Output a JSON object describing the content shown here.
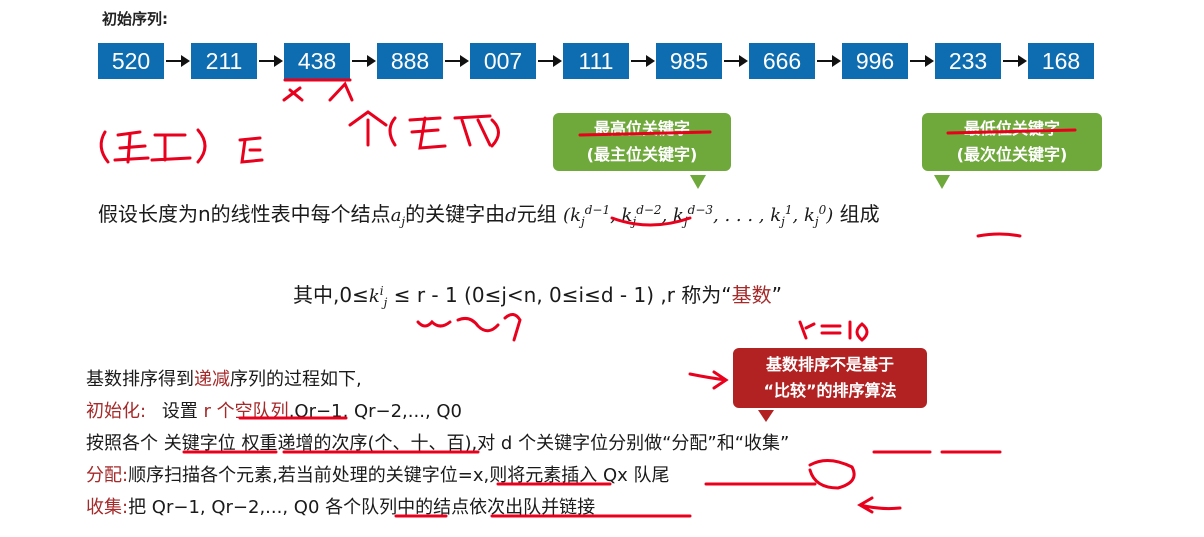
{
  "sequence": {
    "title": "初始序列:",
    "items": [
      "520",
      "211",
      "438",
      "888",
      "007",
      "111",
      "985",
      "666",
      "996",
      "233",
      "168"
    ]
  },
  "callouts": {
    "msd_line1": "最高位关键字",
    "msd_line2": "(最主位关键字)",
    "lsd_line1": "最低位关键字",
    "lsd_line2": "(最次位关键字)",
    "radix_note_line1": "基数排序不是基于",
    "radix_note_line2": "“比较”的排序算法"
  },
  "main": {
    "text_before": "假设长度为n的线性表中每个结点",
    "aj": "a",
    "aj_sub": "j",
    "text_mid": "的关键字由",
    "d_tuple": "d元组",
    "formula": "(k_j^{d-1}, k_j^{d-2}, k_j^{d-3}, ..., k_j^1, k_j^0)",
    "text_after": "组成"
  },
  "line2": {
    "prefix": "其中,0≤",
    "k": "k",
    "sup": "i",
    "sub": "j",
    "mid": "≤ r - 1 (0≤j<n, 0≤i≤d - 1) ,r 称为“",
    "radix": "基数",
    "suffix": "”"
  },
  "process": {
    "intro_before": "基数排序得到",
    "intro_red": "递减",
    "intro_after": "序列的过程如下,",
    "init_label": "初始化:",
    "init_text_before": "设置 ",
    "init_text_red": "r 个空队列",
    "init_text_after": ",Q",
    "init_q": "Qr−1, Qr−2,..., Q0",
    "order_text": "按照各个 关键字位 权重递增的次序(个、十、百),对 d 个关键字位分别做“分配”和“收集”",
    "assign_label": "分配:",
    "assign_text": "顺序扫描各个元素,若当前处理的关键字位=x,则将元素插入 Qx 队尾",
    "collect_label": "收集:",
    "collect_text": "把 Qr−1, Qr−2,..., Q0 各个队列中的结点依次出队并链接"
  },
  "annotations": {
    "ink_color": "#e8001c",
    "r_eq": "r=10",
    "range_0_9": "0~9",
    "left_note": "(最主)位",
    "right_note": "个(最次)"
  },
  "colors": {
    "box": "#0e6db0",
    "callout_green": "#6fa83b",
    "callout_red": "#b22222",
    "label_red": "#a52a2a"
  }
}
